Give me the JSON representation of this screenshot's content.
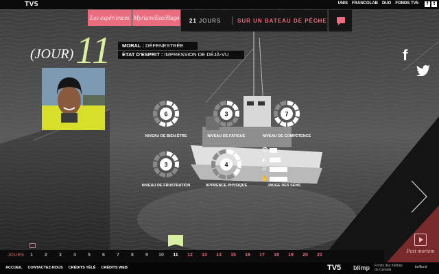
{
  "header": {
    "logo": "TV5",
    "links": [
      "UNIS",
      "FRANCOLAB",
      "DUO",
      "FONDS TV5"
    ],
    "social": [
      "f",
      "t"
    ]
  },
  "tabs": [
    {
      "label": "Les expériences"
    },
    {
      "label": "Myriam/Eza/Hugo"
    }
  ],
  "title": {
    "count": "21",
    "count_label": "JOURS",
    "subtitle": "SUR UN BATEAU DE PÊCHE",
    "star": "*"
  },
  "day": {
    "prefix": "(JOUR)",
    "number": "11",
    "moral_label": "MORAL :",
    "moral_value": "DÉFENESTRÉE",
    "etat_label": "ÉTAT D'ESPRIT :",
    "etat_value": "IMPRESSION DE DÉJÀ-VU"
  },
  "gauges": [
    {
      "label": "NIVEAU DE BIEN-ÊTRE",
      "value": 6,
      "max": 10
    },
    {
      "label": "NIVEAU DE FATIGUE",
      "value": 3,
      "max": 10
    },
    {
      "label": "NIVEAU DE COMPÉTENCE",
      "value": 7,
      "max": 10
    },
    {
      "label": "NIVEAU DE FRUSTRATION",
      "value": 3,
      "max": 10
    },
    {
      "label": "APPRENCE PHYSIQUE",
      "value": 4,
      "max": 10
    }
  ],
  "sens": {
    "label": "JAUGE DES SENS",
    "rows": [
      {
        "icon": "eye-icon",
        "glyph": "👁",
        "level": 0.3
      },
      {
        "icon": "nose-icon",
        "glyph": "◭",
        "level": 0.5
      },
      {
        "icon": "ear-icon",
        "glyph": "ᘐ",
        "level": 0.9
      },
      {
        "icon": "hand-icon",
        "glyph": "✋",
        "level": 0.9
      }
    ]
  },
  "nav": {
    "post_mortem": "Post mortem"
  },
  "timeline": {
    "label": "JOURS",
    "days": [
      "1",
      "2",
      "3",
      "4",
      "5",
      "6",
      "7",
      "8",
      "9",
      "10",
      "11",
      "12",
      "13",
      "14",
      "15",
      "16",
      "17",
      "18",
      "19",
      "20",
      "21"
    ],
    "current": 11
  },
  "footer": {
    "links": [
      "ACCUEIL",
      "CONTACTEZ-NOUS",
      "CRÉDITS TÉLÉ",
      "CRÉDITS WEB"
    ],
    "logo_tv5": "TV5",
    "logo_blimp": "blimp",
    "fonds": "Fonds des médias du Canada",
    "bell": "bellfund"
  },
  "colors": {
    "accent": "#ea6d7f",
    "lime": "#d9eea0"
  }
}
